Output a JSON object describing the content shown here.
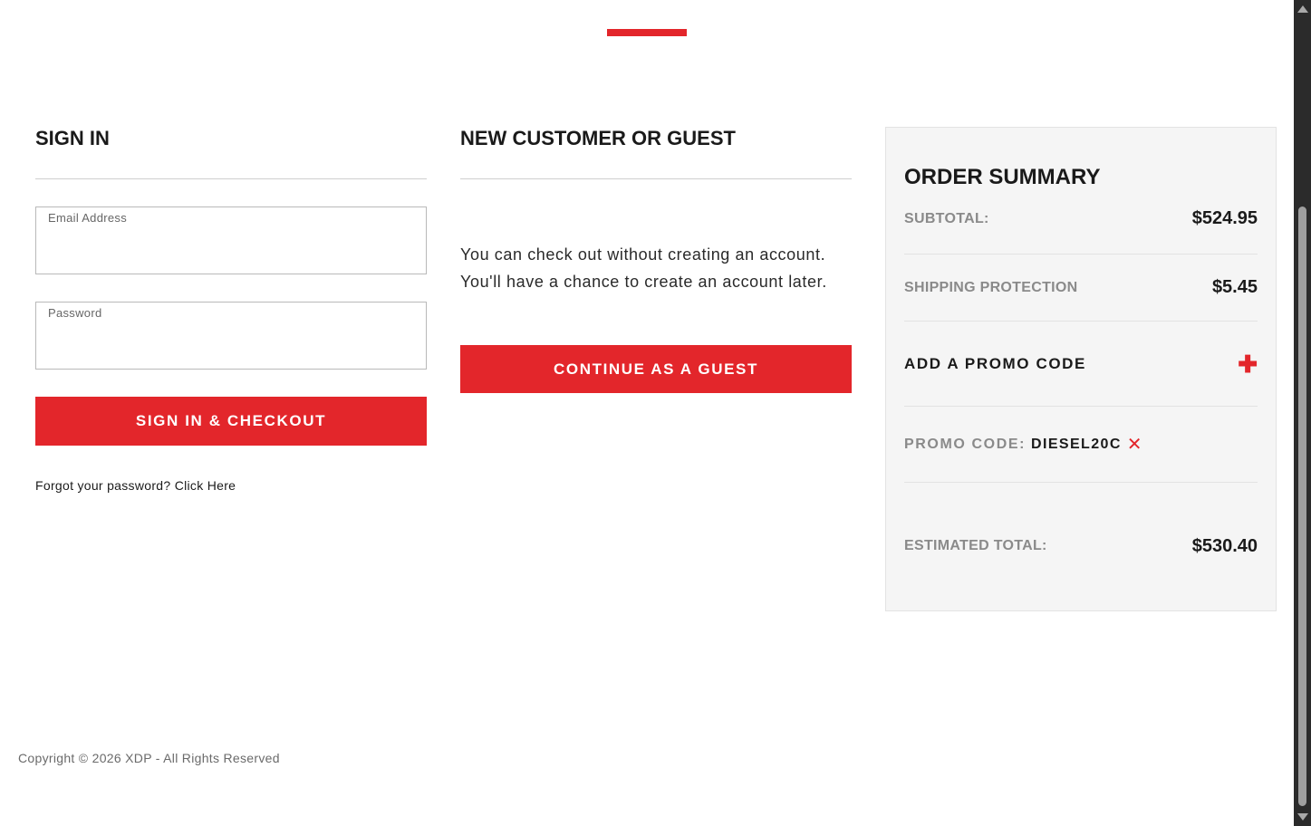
{
  "sign_in": {
    "title": "SIGN IN",
    "email_label": "Email Address",
    "email_value": "",
    "password_label": "Password",
    "password_value": "",
    "submit_label": "SIGN IN & CHECKOUT",
    "forgot_text": "Forgot your password?",
    "forgot_link": "Click Here"
  },
  "guest": {
    "title": "NEW CUSTOMER OR GUEST",
    "line1": "You can check out without creating an account.",
    "line2": "You'll have a chance to create an account later.",
    "button_label": "CONTINUE AS A GUEST"
  },
  "order_summary": {
    "title": "ORDER SUMMARY",
    "subtotal_label": "SUBTOTAL:",
    "subtotal_value": "$524.95",
    "shipping_label": "SHIPPING PROTECTION",
    "shipping_value": "$5.45",
    "promo_add_label": "ADD A PROMO CODE",
    "promo_add_icon": "plus-icon",
    "promo_applied_label": "PROMO CODE:",
    "promo_code": "DIESEL20C",
    "promo_remove_icon": "close-icon",
    "total_label": "ESTIMATED TOTAL:",
    "total_value": "$530.40"
  },
  "footer": {
    "copyright": "Copyright © 2026 XDP - All Rights Reserved"
  },
  "colors": {
    "accent": "#e3262b",
    "summary_bg": "#f5f5f5",
    "muted_text": "#8a8a8a"
  }
}
